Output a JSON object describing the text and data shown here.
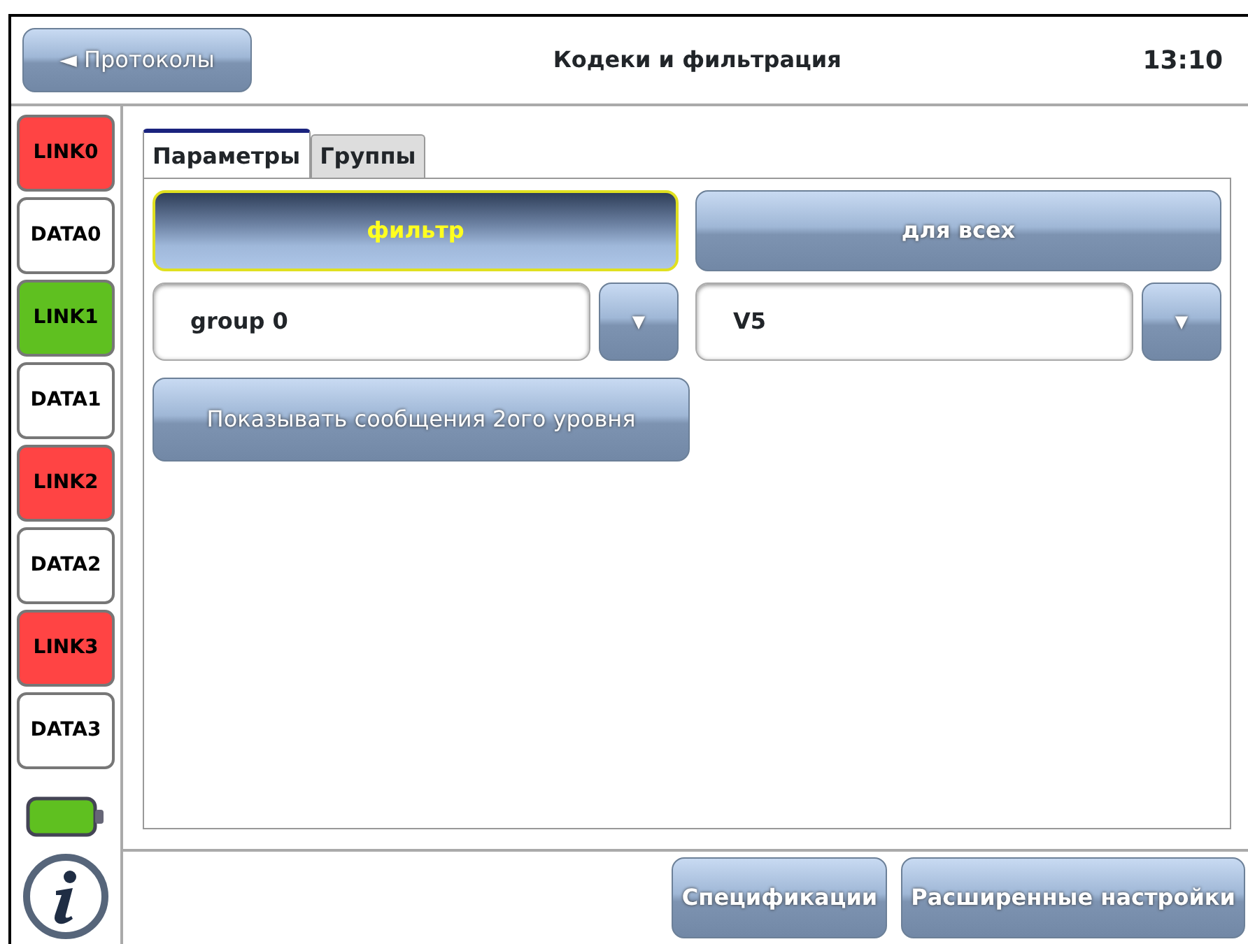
{
  "header": {
    "back_button": "◄ Протоколы",
    "title": "Кодеки и фильтрация",
    "time": "13:10"
  },
  "sidebar": {
    "items": [
      {
        "label": "LINK0",
        "color": "#ff4444"
      },
      {
        "label": "DATA0",
        "color": "#ffffff"
      },
      {
        "label": "LINK1",
        "color": "#5fc020"
      },
      {
        "label": "DATA1",
        "color": "#ffffff"
      },
      {
        "label": "LINK2",
        "color": "#ff4444"
      },
      {
        "label": "DATA2",
        "color": "#ffffff"
      },
      {
        "label": "LINK3",
        "color": "#ff4444"
      },
      {
        "label": "DATA3",
        "color": "#ffffff"
      }
    ]
  },
  "tabs": [
    {
      "label": "Параметры",
      "selected": true
    },
    {
      "label": "Группы",
      "selected": false
    }
  ],
  "mode_buttons": [
    {
      "label": "фильтр",
      "selected": true
    },
    {
      "label": "для всех",
      "selected": false
    }
  ],
  "dropdowns": [
    {
      "value": "group 0",
      "arrow": "▼"
    },
    {
      "value": "V5",
      "arrow": "▼"
    }
  ],
  "show_level2_button": "Показывать сообщения 2ого уровня",
  "footer_buttons": [
    "Спецификации",
    "Расширенные настройки"
  ]
}
